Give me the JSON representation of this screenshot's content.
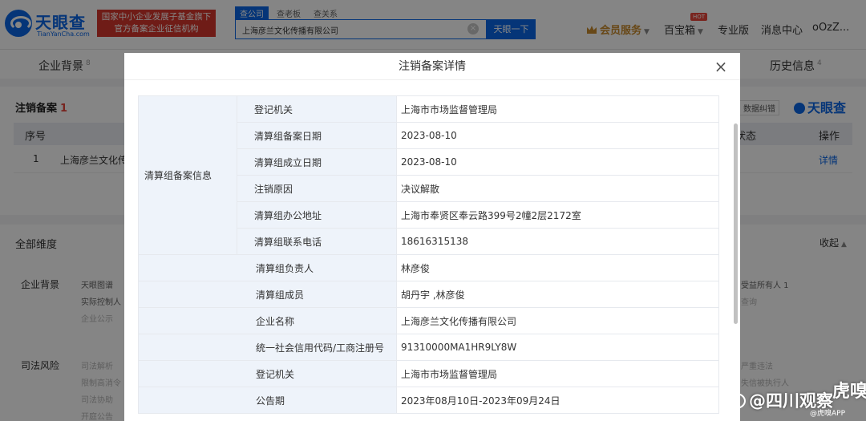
{
  "header": {
    "logo_text": "天眼查",
    "logo_sub": "TianYanCha.com",
    "promo_line1": "国家中小企业发展子基金旗下",
    "promo_line2": "官方备案企业征信机构",
    "search_tabs": [
      "查公司",
      "查老板",
      "查关系"
    ],
    "search_value": "上海彦兰文化传播有限公司",
    "search_button": "天眼一下",
    "vip_label": "会员服务",
    "hot_badge": "HOT",
    "treasure_label": "百宝箱",
    "pro_label": "专业版",
    "message_label": "消息中心",
    "user_label": "oOzZ..."
  },
  "background": {
    "tabs": [
      {
        "label": "企业背景",
        "count": "8"
      },
      {
        "label": "历史信息",
        "count": "4"
      }
    ],
    "section_title": "注销备案",
    "section_count": "1",
    "feedback_label": "数据纠错",
    "brand_label": "天眼查",
    "table_headers": [
      "序号",
      "状态",
      "操作"
    ],
    "table_row": {
      "index": "1",
      "company": "上海彦兰文化传",
      "action": "详情"
    },
    "all_dimensions": "全部维度",
    "collapse_label": "收起",
    "dim_rows": [
      {
        "label": "企业背景",
        "items": [
          "天眼图谱",
          "实际控制人",
          "企业公示"
        ],
        "right": [
          "受益所有人 1",
          "查询"
        ]
      },
      {
        "label": "司法风险",
        "items": [
          "司法解析",
          "限制高消令",
          "司法协助",
          "开庭公告"
        ],
        "right": [
          "严重违法",
          "失信被执行人"
        ]
      }
    ]
  },
  "modal": {
    "title": "注销备案详情",
    "close_glyph": "×",
    "section_label": "清算组备案信息",
    "rows": [
      {
        "key": "登记机关",
        "value": "上海市市场监督管理局"
      },
      {
        "key": "清算组备案日期",
        "value": "2023-08-10"
      },
      {
        "key": "清算组成立日期",
        "value": "2023-08-10"
      },
      {
        "key": "注销原因",
        "value": "决议解散"
      },
      {
        "key": "清算组办公地址",
        "value": "上海市奉贤区奉云路399号2幢2层2172室"
      },
      {
        "key": "清算组联系电话",
        "value": "18616315138"
      },
      {
        "key": "清算组负责人",
        "value": "林彦俊"
      },
      {
        "key": "清算组成员",
        "value": "胡丹宇 ,林彦俊"
      },
      {
        "key": "企业名称",
        "value": "上海彦兰文化传播有限公司"
      },
      {
        "key": "统一社会信用代码/工商注册号",
        "value": "91310000MA1HR9LY8W"
      },
      {
        "key": "登记机关",
        "value": "上海市市场监督管理局"
      },
      {
        "key": "公告期",
        "value": "2023年08月10日-2023年09月24日"
      }
    ]
  },
  "watermark": {
    "text": "@四川观察",
    "top": "虎嗅",
    "sub": "@虎嗅APP"
  },
  "colors": {
    "brand_blue": "#0a66e6",
    "promo_red": "#d5372c",
    "label_bg": "#eef3fa",
    "vip_gold": "#c88a2c"
  },
  "icons": [
    "tianyancha-logo",
    "crown-icon",
    "clear-icon",
    "close-icon",
    "weibo-icon"
  ]
}
